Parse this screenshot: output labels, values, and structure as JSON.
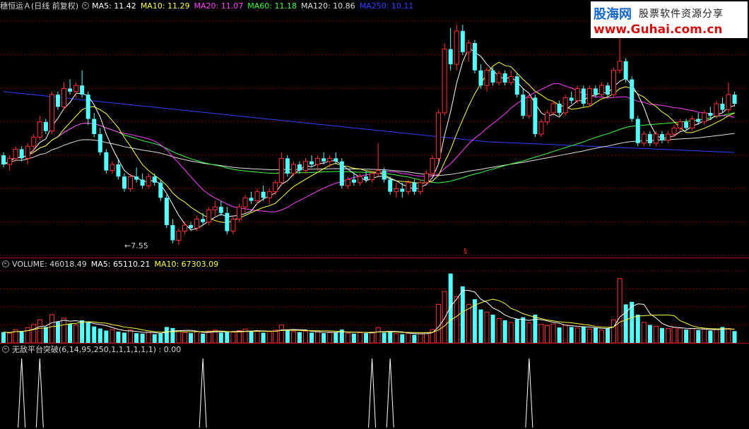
{
  "price_header": {
    "title": "穗恒运Ａ(日线 前复权)",
    "items": [
      {
        "text": "MA5: 11.42",
        "color": "#ffffff"
      },
      {
        "text": "MA10: 11.29",
        "color": "#ffff40"
      },
      {
        "text": "MA20: 11.07",
        "color": "#ff40ff"
      },
      {
        "text": "MA60: 11.18",
        "color": "#40ff40"
      },
      {
        "text": "MA120: 10.86",
        "color": "#e0e0e0"
      },
      {
        "text": "MA250: 10.11",
        "color": "#3040ff"
      }
    ]
  },
  "volume_header": {
    "title": "VOLUME: 46018.49",
    "items": [
      {
        "text": "MA5: 65110.21",
        "color": "#ffffff"
      },
      {
        "text": "MA10: 67303.09",
        "color": "#ffff40"
      }
    ]
  },
  "indicator_header": {
    "title": "无敌平台突破(6,14,95,250,1,1,1,1,1,1) : 0.00"
  },
  "annotations": {
    "low_label": "←7.55",
    "marker": "§"
  },
  "watermark": {
    "logo": "股海网",
    "tagline": "股票软件资源分享",
    "url": "www.Guhai.com.cn"
  },
  "colors": {
    "up": "#ff3232",
    "down": "#54ffff",
    "grid": "#8a0000",
    "ma5": "#ffffff",
    "ma10": "#ffff40",
    "ma20": "#ff40ff",
    "ma60": "#40ff40",
    "ma120": "#e0e0e0",
    "ma250": "#3040ff"
  },
  "chart_data": [
    {
      "type": "candlestick",
      "panel": "price",
      "ylim": [
        7.2,
        15.2
      ],
      "lowest_low": 7.55,
      "ohlc": [
        [
          10.5,
          10.6,
          10.1,
          10.2
        ],
        [
          10.2,
          10.5,
          10.0,
          10.4
        ],
        [
          10.4,
          10.8,
          10.3,
          10.7
        ],
        [
          10.7,
          10.8,
          10.3,
          10.4
        ],
        [
          10.4,
          10.9,
          10.2,
          10.8
        ],
        [
          10.8,
          11.2,
          10.6,
          11.1
        ],
        [
          11.1,
          11.8,
          11.0,
          11.6
        ],
        [
          11.6,
          11.7,
          11.2,
          11.3
        ],
        [
          11.3,
          12.6,
          11.2,
          12.5
        ],
        [
          12.5,
          12.6,
          12.0,
          12.1
        ],
        [
          12.1,
          12.9,
          12.0,
          12.7
        ],
        [
          12.7,
          13.0,
          12.5,
          12.6
        ],
        [
          12.6,
          12.9,
          12.4,
          12.8
        ],
        [
          12.8,
          13.3,
          12.4,
          12.5
        ],
        [
          12.5,
          12.6,
          11.5,
          11.7
        ],
        [
          11.7,
          11.9,
          11.1,
          11.2
        ],
        [
          11.2,
          11.4,
          10.5,
          10.6
        ],
        [
          10.6,
          10.7,
          9.9,
          10.0
        ],
        [
          10.0,
          10.3,
          9.9,
          10.2
        ],
        [
          10.2,
          10.4,
          9.7,
          9.8
        ],
        [
          9.8,
          9.9,
          9.3,
          9.4
        ],
        [
          9.4,
          9.9,
          9.3,
          9.8
        ],
        [
          9.8,
          10.1,
          9.6,
          9.7
        ],
        [
          9.7,
          9.9,
          9.4,
          9.5
        ],
        [
          9.5,
          9.9,
          9.4,
          9.8
        ],
        [
          9.8,
          9.9,
          9.5,
          9.6
        ],
        [
          9.6,
          9.7,
          9.0,
          9.1
        ],
        [
          9.1,
          9.2,
          8.1,
          8.2
        ],
        [
          8.2,
          8.4,
          7.6,
          7.7
        ],
        [
          7.7,
          8.1,
          7.55,
          8.0
        ],
        [
          8.0,
          8.3,
          7.9,
          8.2
        ],
        [
          8.2,
          8.3,
          8.0,
          8.1
        ],
        [
          8.1,
          8.5,
          8.0,
          8.4
        ],
        [
          8.4,
          8.6,
          8.2,
          8.3
        ],
        [
          8.3,
          8.8,
          8.2,
          8.7
        ],
        [
          8.7,
          9.0,
          8.5,
          8.8
        ],
        [
          8.8,
          9.0,
          8.5,
          8.6
        ],
        [
          8.6,
          8.8,
          7.9,
          8.0
        ],
        [
          8.0,
          8.5,
          7.9,
          8.4
        ],
        [
          8.4,
          8.9,
          8.3,
          8.8
        ],
        [
          8.8,
          9.2,
          8.6,
          9.1
        ],
        [
          9.1,
          9.3,
          8.9,
          9.0
        ],
        [
          9.0,
          9.4,
          8.9,
          9.3
        ],
        [
          9.3,
          9.5,
          9.0,
          9.1
        ],
        [
          9.1,
          9.4,
          8.9,
          9.3
        ],
        [
          9.3,
          9.7,
          9.2,
          9.6
        ],
        [
          9.6,
          10.6,
          9.5,
          10.4
        ],
        [
          10.4,
          10.5,
          9.8,
          9.9
        ],
        [
          9.9,
          10.3,
          9.8,
          10.2
        ],
        [
          10.2,
          10.3,
          9.9,
          10.0
        ],
        [
          10.0,
          10.4,
          9.9,
          10.3
        ],
        [
          10.3,
          10.5,
          10.1,
          10.2
        ],
        [
          10.2,
          10.5,
          10.0,
          10.4
        ],
        [
          10.4,
          10.6,
          10.2,
          10.3
        ],
        [
          10.3,
          10.5,
          10.1,
          10.4
        ],
        [
          10.4,
          10.6,
          10.2,
          10.3
        ],
        [
          10.3,
          10.4,
          9.4,
          9.5
        ],
        [
          9.5,
          9.8,
          9.4,
          9.7
        ],
        [
          9.7,
          9.9,
          9.5,
          9.6
        ],
        [
          9.6,
          9.9,
          9.5,
          9.8
        ],
        [
          9.8,
          10.0,
          9.6,
          9.7
        ],
        [
          9.7,
          10.0,
          9.6,
          9.9
        ],
        [
          9.9,
          10.9,
          9.8,
          10.0
        ],
        [
          10.0,
          10.1,
          9.6,
          9.7
        ],
        [
          9.7,
          9.8,
          9.2,
          9.3
        ],
        [
          9.3,
          9.6,
          9.1,
          9.4
        ],
        [
          9.4,
          9.6,
          9.1,
          9.3
        ],
        [
          9.3,
          9.7,
          9.2,
          9.6
        ],
        [
          9.6,
          9.7,
          9.2,
          9.3
        ],
        [
          9.3,
          9.7,
          9.2,
          9.6
        ],
        [
          9.6,
          10.0,
          9.5,
          9.9
        ],
        [
          9.9,
          10.5,
          9.8,
          10.4
        ],
        [
          10.4,
          12.0,
          10.3,
          11.9
        ],
        [
          11.9,
          14.2,
          11.8,
          14.0
        ],
        [
          14.0,
          14.7,
          13.3,
          13.5
        ],
        [
          13.5,
          14.8,
          13.3,
          14.6
        ],
        [
          14.6,
          14.8,
          13.8,
          13.9
        ],
        [
          13.9,
          14.3,
          13.6,
          14.2
        ],
        [
          14.2,
          14.3,
          13.2,
          13.3
        ],
        [
          13.3,
          13.5,
          12.7,
          12.8
        ],
        [
          12.8,
          13.4,
          12.6,
          13.3
        ],
        [
          13.3,
          13.4,
          12.8,
          12.9
        ],
        [
          12.9,
          13.3,
          12.8,
          13.2
        ],
        [
          13.2,
          13.3,
          12.8,
          12.9
        ],
        [
          12.9,
          13.3,
          12.8,
          13.1
        ],
        [
          13.1,
          13.2,
          12.4,
          12.5
        ],
        [
          12.5,
          12.7,
          11.7,
          11.8
        ],
        [
          11.8,
          12.5,
          11.7,
          12.4
        ],
        [
          12.4,
          12.5,
          11.1,
          11.2
        ],
        [
          11.2,
          11.7,
          11.1,
          11.6
        ],
        [
          11.6,
          12.0,
          11.5,
          11.9
        ],
        [
          11.9,
          12.3,
          11.8,
          12.2
        ],
        [
          12.2,
          12.3,
          11.8,
          11.9
        ],
        [
          11.9,
          12.5,
          11.8,
          12.4
        ],
        [
          12.4,
          12.6,
          12.2,
          12.3
        ],
        [
          12.3,
          12.8,
          12.2,
          12.7
        ],
        [
          12.7,
          12.8,
          12.1,
          12.2
        ],
        [
          12.2,
          12.8,
          12.1,
          12.7
        ],
        [
          12.7,
          12.8,
          12.4,
          12.5
        ],
        [
          12.5,
          12.9,
          12.4,
          12.8
        ],
        [
          12.8,
          12.9,
          12.4,
          12.5
        ],
        [
          12.5,
          13.4,
          12.4,
          13.3
        ],
        [
          13.3,
          14.6,
          13.2,
          13.6
        ],
        [
          13.6,
          13.7,
          12.9,
          13.0
        ],
        [
          13.0,
          13.1,
          11.6,
          11.7
        ],
        [
          11.7,
          11.8,
          10.8,
          10.9
        ],
        [
          10.9,
          11.3,
          10.8,
          11.2
        ],
        [
          11.2,
          11.3,
          10.8,
          10.9
        ],
        [
          10.9,
          11.3,
          10.8,
          11.2
        ],
        [
          11.2,
          11.3,
          10.9,
          11.0
        ],
        [
          11.0,
          11.3,
          10.9,
          11.2
        ],
        [
          11.2,
          11.5,
          11.1,
          11.4
        ],
        [
          11.4,
          11.7,
          11.3,
          11.6
        ],
        [
          11.6,
          11.7,
          11.3,
          11.4
        ],
        [
          11.4,
          11.8,
          11.3,
          11.7
        ],
        [
          11.7,
          11.9,
          11.5,
          11.6
        ],
        [
          11.6,
          12.0,
          11.5,
          11.9
        ],
        [
          11.9,
          12.1,
          11.7,
          11.8
        ],
        [
          11.8,
          12.3,
          11.7,
          12.2
        ],
        [
          12.2,
          12.4,
          11.9,
          12.0
        ],
        [
          12.0,
          12.9,
          11.9,
          12.5
        ],
        [
          12.5,
          12.6,
          12.1,
          12.2
        ]
      ]
    },
    {
      "type": "bar",
      "panel": "volume",
      "ylim": [
        0,
        280000
      ],
      "values": [
        42000,
        38000,
        52000,
        46000,
        60000,
        72000,
        90000,
        62000,
        110000,
        82000,
        96000,
        74000,
        70000,
        88000,
        80000,
        64000,
        56000,
        48000,
        52000,
        44000,
        40000,
        50000,
        38000,
        36000,
        42000,
        34000,
        36000,
        62000,
        58000,
        48000,
        40000,
        38000,
        44000,
        36000,
        46000,
        50000,
        40000,
        44000,
        42000,
        48000,
        54000,
        44000,
        48000,
        40000,
        44000,
        50000,
        70000,
        52000,
        44000,
        42000,
        46000,
        40000,
        44000,
        38000,
        40000,
        42000,
        52000,
        38000,
        36000,
        40000,
        38000,
        42000,
        60000,
        40000,
        44000,
        36000,
        34000,
        38000,
        32000,
        36000,
        40000,
        52000,
        150000,
        200000,
        270000,
        180000,
        220000,
        150000,
        170000,
        130000,
        120000,
        110000,
        95000,
        88000,
        80000,
        92000,
        100000,
        78000,
        110000,
        72000,
        68000,
        74000,
        60000,
        70000,
        62000,
        58000,
        64000,
        54000,
        58000,
        50000,
        56000,
        90000,
        250000,
        150000,
        160000,
        110000,
        80000,
        70000,
        64000,
        58000,
        56000,
        60000,
        58000,
        52000,
        56000,
        50000,
        54000,
        48000,
        52000,
        62000,
        56000,
        46018.49
      ]
    },
    {
      "type": "line",
      "panel": "indicator",
      "title": "无敌平台突破",
      "ylim": [
        0,
        1
      ],
      "signal_days": [
        3,
        6,
        33,
        61,
        64,
        87
      ],
      "value": 0.0
    }
  ]
}
